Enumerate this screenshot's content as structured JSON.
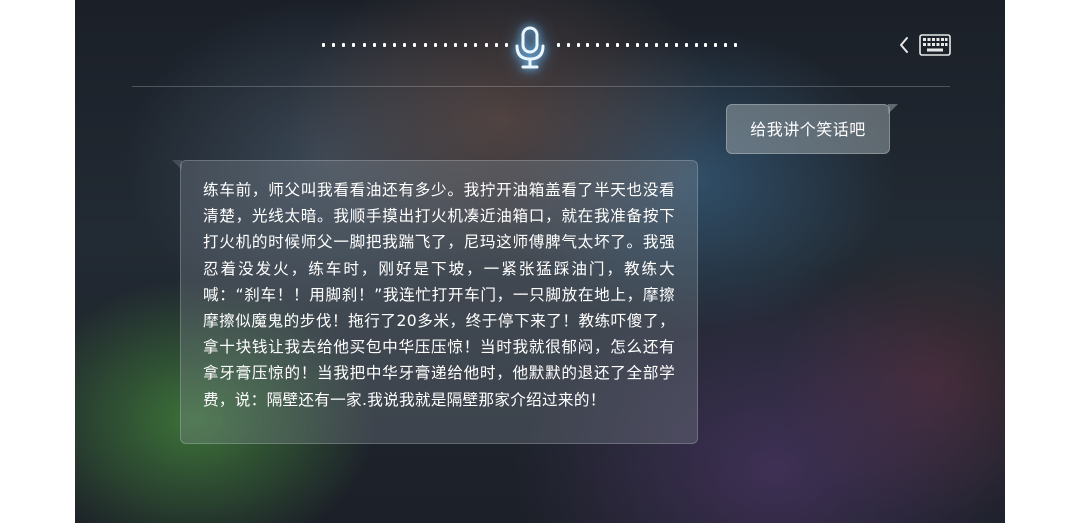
{
  "voice_bar": {
    "mic_icon": "microphone-icon",
    "back_icon": "chevron-left-icon",
    "keyboard_icon": "keyboard-icon",
    "accent_color": "#8fd3ff"
  },
  "conversation": {
    "user_message": "给我讲个笑话吧",
    "assistant_message": "练车前，师父叫我看看油还有多少。我拧开油箱盖看了半天也没看清楚，光线太暗。我顺手摸出打火机凑近油箱口，就在我准备按下打火机的时候师父一脚把我踹飞了，尼玛这师傅脾气太坏了。我强忍着没发火，练车时，刚好是下坡，一紧张猛踩油门，教练大喊：“刹车！！用脚刹！”我连忙打开车门，一只脚放在地上，摩擦摩擦似魔鬼的步伐！拖行了20多米，终于停下来了！教练吓傻了，拿十块钱让我去给他买包中华压压惊！当时我就很郁闷，怎么还有拿牙膏压惊的！当我把中华牙膏递给他时，他默默的退还了全部学费，说：隔壁还有一家.我说我就是隔壁那家介绍过来的！"
  }
}
